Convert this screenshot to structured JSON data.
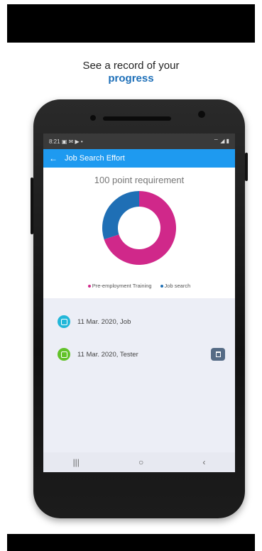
{
  "headline": {
    "line1": "See a record of your",
    "line2": "progress"
  },
  "status_bar": {
    "time": "8:21",
    "left_icons": "▣ ✉ ▶ •",
    "right_icons": "⌔ ◢ ▮"
  },
  "app_bar": {
    "back_icon": "←",
    "title": "Job Search Effort"
  },
  "chart_data": {
    "type": "pie",
    "title": "100 point requirement",
    "labels": [
      "Pre-employment Training",
      "Job search"
    ],
    "values": [
      70,
      30
    ],
    "colors": [
      "#d0288a",
      "#1f6fb5"
    ]
  },
  "entries": [
    {
      "text": "11 Mar. 2020, Job",
      "icon": "document-icon",
      "color": "#22b7d9"
    },
    {
      "text": "11 Mar. 2020, Tester",
      "icon": "training-icon",
      "color": "#62c22a"
    }
  ],
  "nav": {
    "recents": "|||",
    "home": "○",
    "back": "‹"
  }
}
